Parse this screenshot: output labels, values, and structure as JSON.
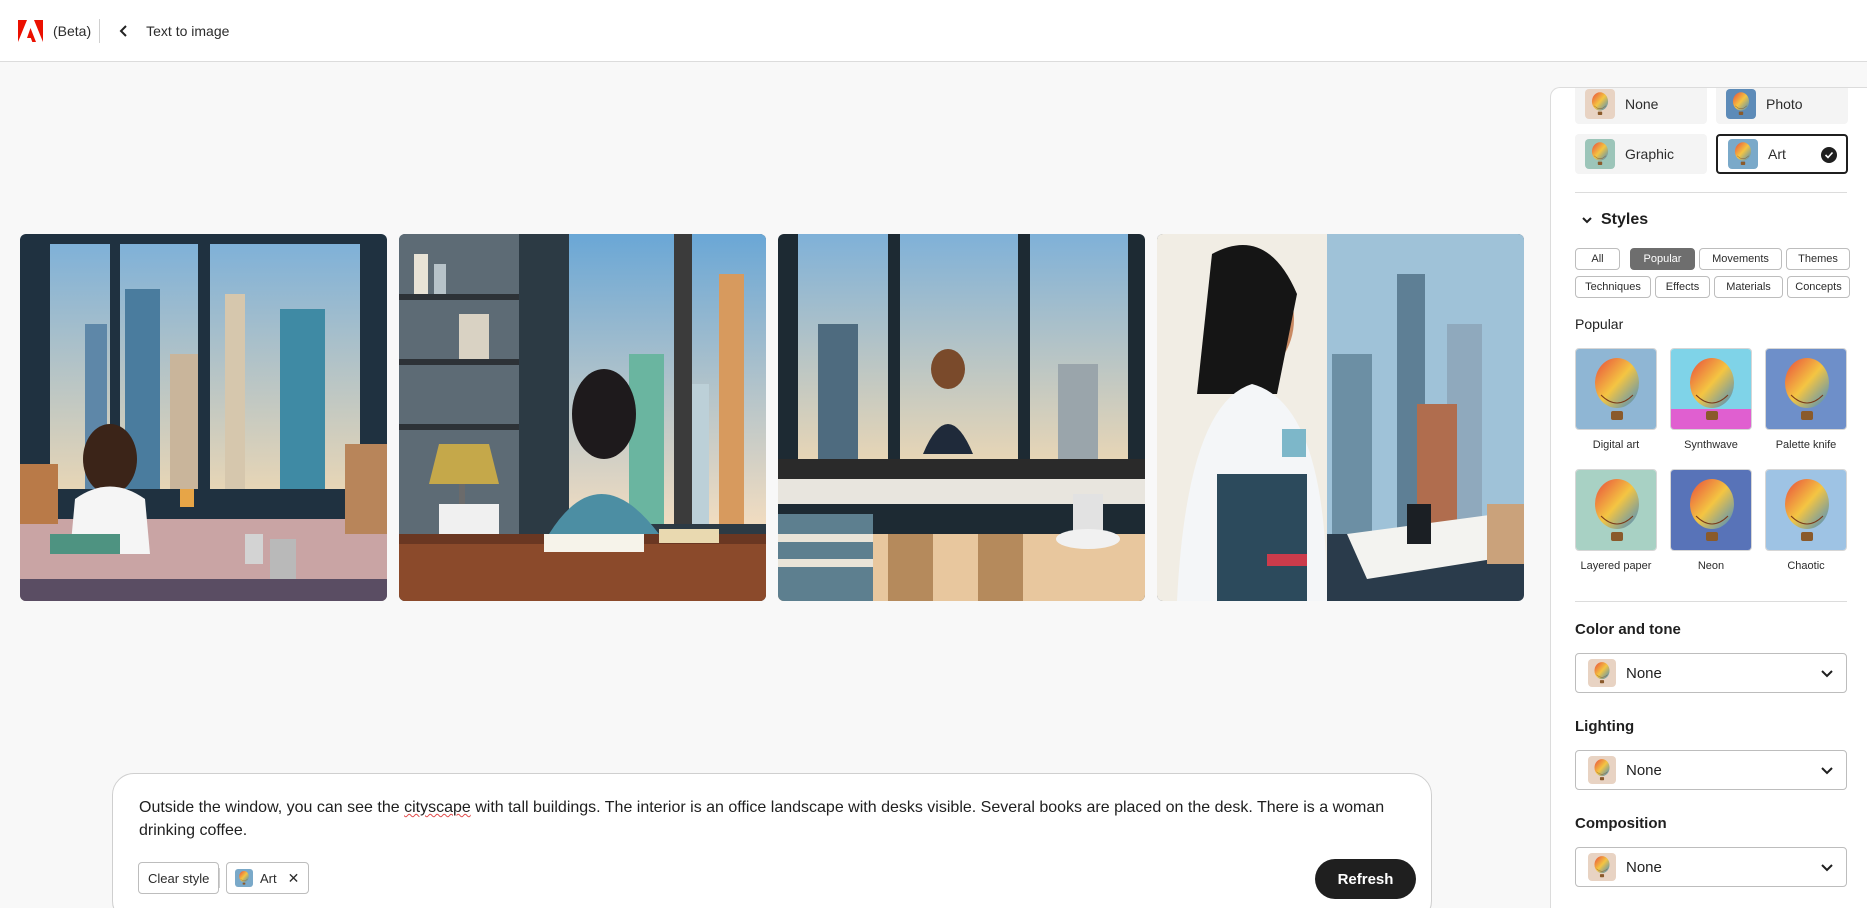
{
  "header": {
    "beta_label": "(Beta)",
    "page_title": "Text to image"
  },
  "images": [
    {
      "alt": "Woman at desk with coffee viewing skyline"
    },
    {
      "alt": "Woman reading at desk with lamp and bookshelves"
    },
    {
      "alt": "Woman at window desk with coffee cups"
    },
    {
      "alt": "Woman holding mug beside city view"
    }
  ],
  "prompt": {
    "text_before": "Outside the window, you can see the ",
    "text_misspelled": "cityscape",
    "text_after": " with tall buildings. The interior is an office landscape with desks visible. Several books are placed on the desk. There is a woman drinking coffee.",
    "clear_style_label": "Clear style",
    "style_chip_label": "Art",
    "chip_remove_glyph": "✕",
    "refresh_label": "Refresh"
  },
  "panel": {
    "content_types": [
      {
        "label": "None",
        "selected": false
      },
      {
        "label": "Photo",
        "selected": false
      },
      {
        "label": "Graphic",
        "selected": false
      },
      {
        "label": "Art",
        "selected": true
      }
    ],
    "styles_heading": "Styles",
    "style_filters": [
      {
        "label": "All",
        "active": false
      },
      {
        "label": "Popular",
        "active": true
      },
      {
        "label": "Movements",
        "active": false
      },
      {
        "label": "Themes",
        "active": false
      },
      {
        "label": "Techniques",
        "active": false
      },
      {
        "label": "Effects",
        "active": false
      },
      {
        "label": "Materials",
        "active": false
      },
      {
        "label": "Concepts",
        "active": false
      }
    ],
    "popular_heading": "Popular",
    "popular_styles": [
      {
        "label": "Digital art"
      },
      {
        "label": "Synthwave"
      },
      {
        "label": "Palette knife"
      },
      {
        "label": "Layered paper"
      },
      {
        "label": "Neon"
      },
      {
        "label": "Chaotic"
      }
    ],
    "color_tone": {
      "heading": "Color and tone",
      "value": "None"
    },
    "lighting": {
      "heading": "Lighting",
      "value": "None"
    },
    "composition": {
      "heading": "Composition",
      "value": "None"
    }
  },
  "colors": {
    "adobe_red": "#eb1000",
    "primary_dark": "#1f1f1f",
    "active_pill": "#6e6e6e"
  }
}
